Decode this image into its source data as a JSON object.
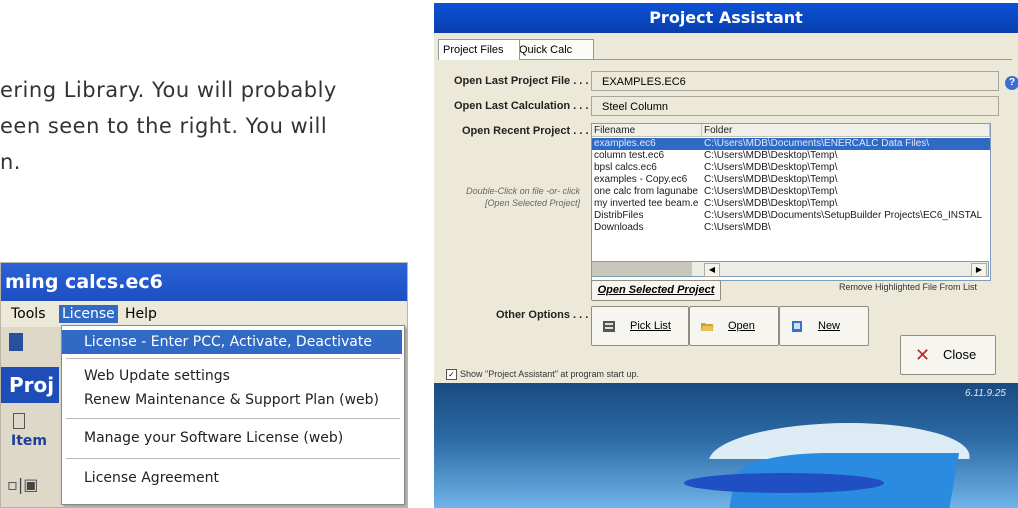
{
  "document": {
    "line1": "ering Library. You will probably",
    "line2": "een seen to the right. You will",
    "line3": "n."
  },
  "license_menu": {
    "title": "ming calcs.ec6",
    "menubar": [
      "Tools",
      "License",
      "Help"
    ],
    "project_fragment": "Proj",
    "item_label": "Item",
    "items": [
      "License - Enter PCC, Activate, Deactivate",
      "Web Update settings",
      "Renew Maintenance & Support Plan  (web)",
      "Manage your Software License  (web)",
      "License Agreement"
    ]
  },
  "project_assistant": {
    "title": "Project Assistant",
    "tabs": [
      "Project Files",
      "Quick Calc"
    ],
    "labels": {
      "last_project": "Open Last Project File . . .",
      "last_calc": "Open Last Calculation . . .",
      "recent": "Open Recent Project . . .",
      "other": "Other Options . . ."
    },
    "last_project_value": "EXAMPLES.EC6",
    "last_calc_value": "Steel Column",
    "hint": "Double-Click on file -or- click [Open Selected Project]",
    "list_headers": [
      "Filename",
      "Folder"
    ],
    "files": [
      {
        "name": "examples.ec6",
        "folder": "C:\\Users\\MDB\\Documents\\ENERCALC Data Files\\"
      },
      {
        "name": "column test.ec6",
        "folder": "C:\\Users\\MDB\\Desktop\\Temp\\"
      },
      {
        "name": "bpsl calcs.ec6",
        "folder": "C:\\Users\\MDB\\Desktop\\Temp\\"
      },
      {
        "name": "examples - Copy.ec6",
        "folder": "C:\\Users\\MDB\\Desktop\\Temp\\"
      },
      {
        "name": "one calc from lagunabe",
        "folder": "C:\\Users\\MDB\\Desktop\\Temp\\"
      },
      {
        "name": "my inverted tee beam.e",
        "folder": "C:\\Users\\MDB\\Desktop\\Temp\\"
      },
      {
        "name": "DistribFiles",
        "folder": "C:\\Users\\MDB\\Documents\\SetupBuilder Projects\\EC6_INSTAL"
      },
      {
        "name": "Downloads",
        "folder": "C:\\Users\\MDB\\"
      }
    ],
    "open_selected": "Open Selected Project",
    "remove": "Remove Highlighted File From List",
    "buttons": {
      "pick_list": "Pick List",
      "open": "Open",
      "new": "New",
      "close": "Close"
    },
    "show_at_startup": "Show \"Project Assistant\" at program start up.",
    "version": "6.11.9.25",
    "help_glyph": "?"
  }
}
